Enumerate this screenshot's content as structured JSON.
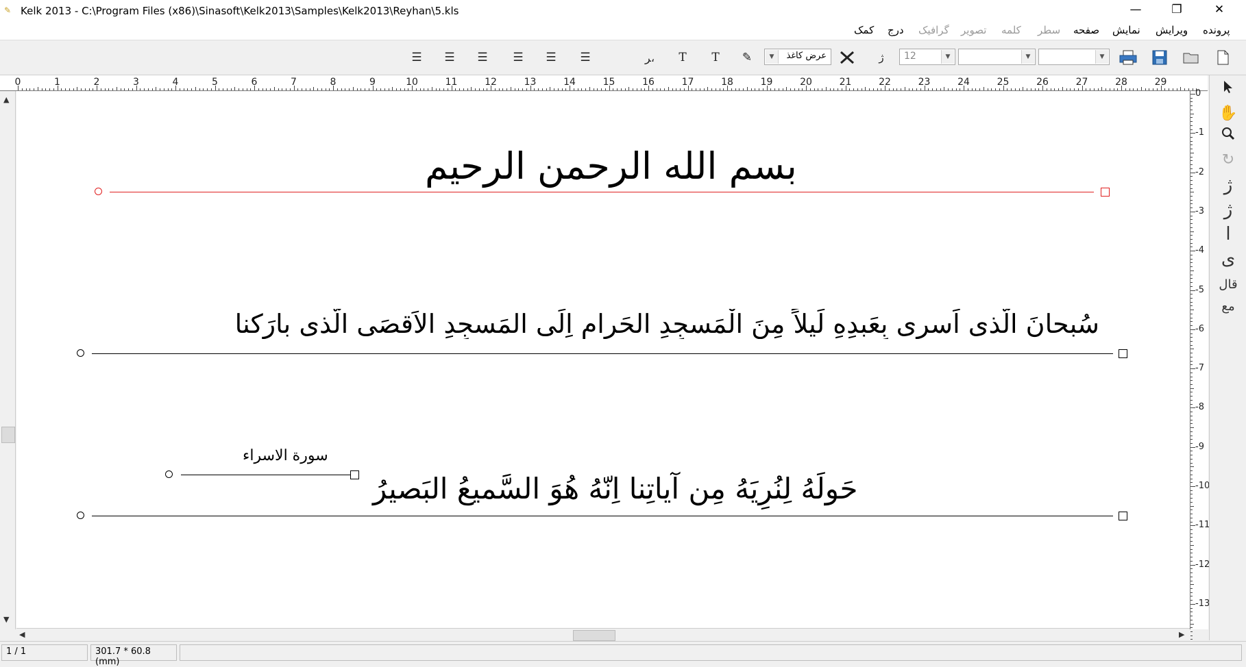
{
  "window": {
    "title": "Kelk 2013 - C:\\Program Files (x86)\\Sinasoft\\Kelk2013\\Samples\\Kelk2013\\Reyhan\\5.kls",
    "minimize": "—",
    "restore": "❐",
    "close": "✕"
  },
  "menu": {
    "items": [
      "پرونده",
      "ویرایش",
      "نمایش",
      "صفحه",
      "سطر",
      "کلمه",
      "تصویر",
      "گرافیک",
      "درج",
      "کمک"
    ],
    "disabled": [
      "سطر",
      "کلمه",
      "تصویر",
      "گرافیک"
    ]
  },
  "toolbar": {
    "font_size": "12",
    "width_select": "عرض کاغذ",
    "font_combo_1": "",
    "font_combo_2": "",
    "icons": [
      "new-file-icon",
      "open-folder-icon",
      "save-icon",
      "print-icon",
      "tools-icon",
      "pen-icon",
      "text-size-icon",
      "text-style-icon",
      "align-icons"
    ]
  },
  "ruler": {
    "h_numbers": [
      "0",
      "1",
      "2",
      "3",
      "4",
      "5",
      "6",
      "7",
      "8",
      "9",
      "10",
      "11",
      "12",
      "13",
      "14",
      "15",
      "16",
      "17",
      "18",
      "19",
      "20",
      "21",
      "22",
      "23",
      "24",
      "25",
      "26",
      "27",
      "28",
      "29"
    ],
    "v_numbers": [
      "0",
      "1",
      "2",
      "3",
      "4",
      "5",
      "6",
      "7",
      "8",
      "9",
      "10",
      "11",
      "12",
      "13"
    ]
  },
  "document": {
    "line1": "بسم الله الرحمن الرحیم",
    "line2": "سُبحانَ الّذی اَسری بِعَبدِهِ لَیلاً مِنَ الْمَسجِدِ الحَرامِ اِلَی المَسجِدِ الاَقصَی الّذی بارَکنا",
    "line3_label": "سورة الاسراء",
    "line3": "حَولَهُ لِنُرِیَهُ مِن آیاتِنا اِنّهُ هُوَ السَّمیعُ البَصیرُ",
    "selected_line_color": "#e02020"
  },
  "tools": {
    "glyphs": [
      "↖",
      "✋",
      "🔍",
      "↻",
      "ژ",
      "ﮊ",
      "ا",
      "ی",
      "قال",
      "مع"
    ]
  },
  "status": {
    "page": "1 / 1",
    "size": "301.7 * 60.8 (mm)"
  }
}
